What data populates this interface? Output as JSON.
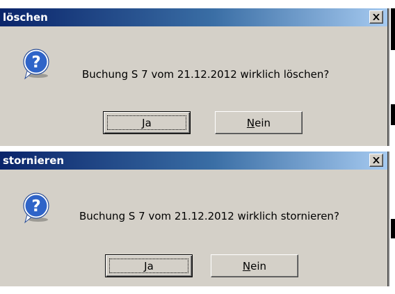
{
  "dialogs": [
    {
      "title": "löschen",
      "message": "Buchung S 7 vom 21.12.2012 wirklich löschen?",
      "buttons": {
        "yes": {
          "mnemonic": "J",
          "rest": "a"
        },
        "no": {
          "mnemonic": "N",
          "rest": "ein"
        }
      }
    },
    {
      "title": "stornieren",
      "message": "Buchung S 7 vom 21.12.2012 wirklich stornieren?",
      "buttons": {
        "yes": {
          "mnemonic": "J",
          "rest": "a"
        },
        "no": {
          "mnemonic": "N",
          "rest": "ein"
        }
      }
    }
  ],
  "icons": {
    "dialog": "question-icon",
    "close": "close-icon"
  },
  "colors": {
    "dialog_bg": "#d4d0c8",
    "titlebar_start": "#0a246a",
    "titlebar_end": "#a6caf0",
    "icon_fill": "#2f64c8"
  }
}
